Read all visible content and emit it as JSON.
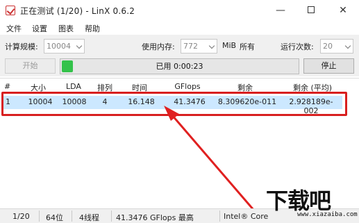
{
  "window": {
    "title": "正在测试 (1/20) - LinX 0.6.2",
    "icons": {
      "app": "checkmark-app-icon",
      "minimize": "minimize-icon",
      "maximize": "maximize-icon",
      "close": "close-icon"
    }
  },
  "menu": [
    "文件",
    "设置",
    "图表",
    "帮助"
  ],
  "controls": {
    "size_label": "计算规模:",
    "size_value": "10004",
    "memory_label": "使用内存:",
    "memory_value": "772",
    "memory_unit": "MiB",
    "memory_all": "所有",
    "runs_label": "运行次数:",
    "runs_value": "20"
  },
  "actions": {
    "start_label": "开始",
    "stop_label": "停止",
    "elapsed_text": "已用 0:00:23",
    "progress_fraction": 0.047
  },
  "table": {
    "headers": [
      "#",
      "大小",
      "LDA",
      "排列",
      "时间",
      "GFlops",
      "剩余",
      "剩余 (平均)"
    ],
    "rows": [
      [
        "1",
        "10004",
        "10008",
        "4",
        "16.148",
        "41.3476",
        "8.309620e-011",
        "2.928189e-002"
      ]
    ]
  },
  "status": {
    "progress": "1/20",
    "bits": "64位",
    "threads": "4线程",
    "peak": "41.3476 GFlops 最高",
    "cpu": "Intel® Core"
  },
  "watermark": {
    "main": "下载吧",
    "url": "www.xiazaiba.com"
  },
  "colors": {
    "highlight": "#d81f1f",
    "progress": "#33c24a",
    "selected_row": "#cce8ff"
  }
}
